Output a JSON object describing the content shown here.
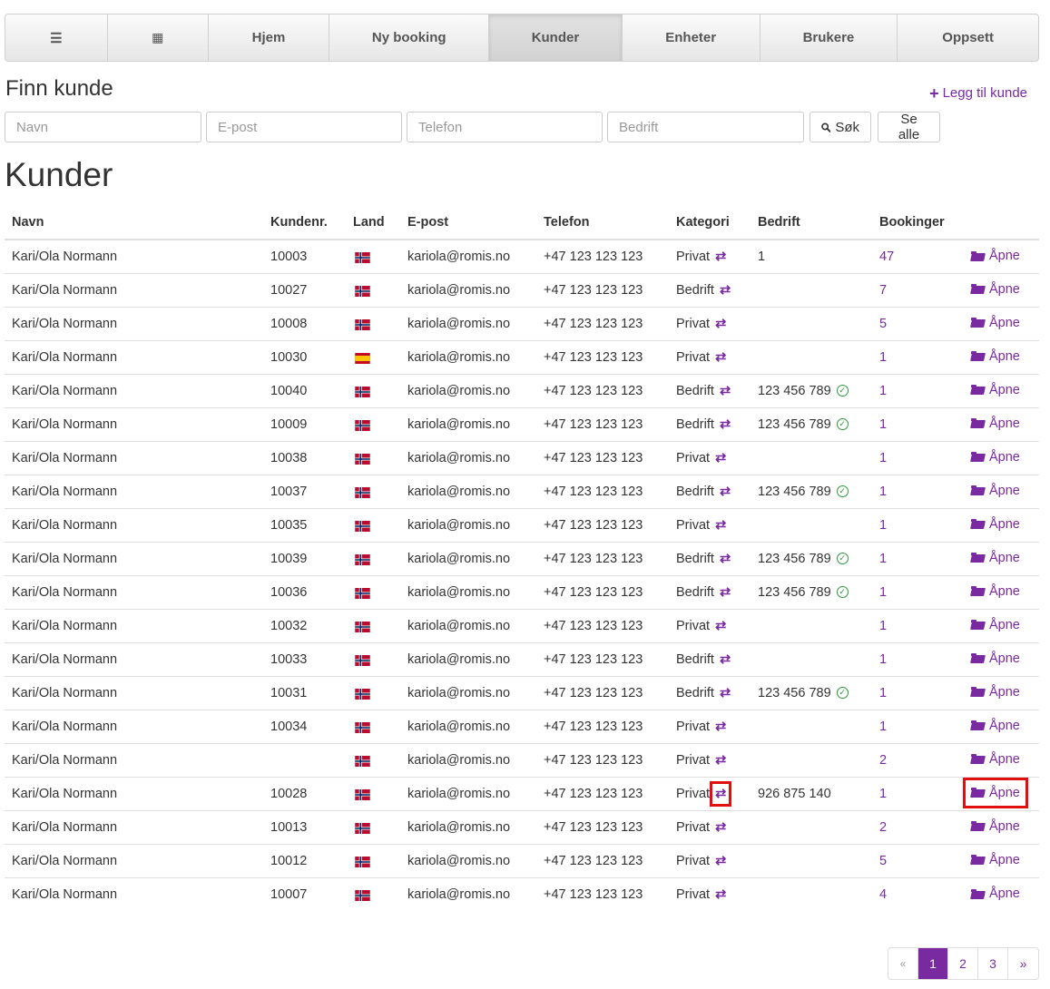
{
  "nav": {
    "items": [
      {
        "label": "☰",
        "icon": "menu-icon"
      },
      {
        "label": "▦",
        "icon": "calendar-icon"
      },
      {
        "label": "Hjem"
      },
      {
        "label": "Ny booking"
      },
      {
        "label": "Kunder"
      },
      {
        "label": "Enheter"
      },
      {
        "label": "Brukere"
      },
      {
        "label": "Oppsett"
      }
    ],
    "active": "Kunder"
  },
  "search": {
    "title": "Finn kunde",
    "add_label": "Legg til kunde",
    "name_placeholder": "Navn",
    "email_placeholder": "E-post",
    "phone_placeholder": "Telefon",
    "company_placeholder": "Bedrift",
    "search_label": "Søk",
    "show_all_label": "Se alle"
  },
  "table": {
    "title": "Kunder",
    "headers": [
      "Navn",
      "Kundenr.",
      "Land",
      "E-post",
      "Telefon",
      "Kategori",
      "Bedrift",
      "Bookinger",
      ""
    ],
    "open_label": "Åpne",
    "rows": [
      {
        "name": "Kari/Ola Normann",
        "no": "10003",
        "country": "NO",
        "email": "kariola@romis.no",
        "phone": "+47 123 123 123",
        "category": "Privat",
        "company": "1",
        "verified": false,
        "bookings": "47"
      },
      {
        "name": "Kari/Ola Normann",
        "no": "10027",
        "country": "NO",
        "email": "kariola@romis.no",
        "phone": "+47 123 123 123",
        "category": "Bedrift",
        "company": "",
        "verified": false,
        "bookings": "7"
      },
      {
        "name": "Kari/Ola Normann",
        "no": "10008",
        "country": "NO",
        "email": "kariola@romis.no",
        "phone": "+47 123 123 123",
        "category": "Privat",
        "company": "",
        "verified": false,
        "bookings": "5"
      },
      {
        "name": "Kari/Ola Normann",
        "no": "10030",
        "country": "ES",
        "email": "kariola@romis.no",
        "phone": "+47 123 123 123",
        "category": "Privat",
        "company": "",
        "verified": false,
        "bookings": "1"
      },
      {
        "name": "Kari/Ola Normann",
        "no": "10040",
        "country": "NO",
        "email": "kariola@romis.no",
        "phone": "+47 123 123 123",
        "category": "Bedrift",
        "company": "123 456 789",
        "verified": true,
        "bookings": "1"
      },
      {
        "name": "Kari/Ola Normann",
        "no": "10009",
        "country": "NO",
        "email": "kariola@romis.no",
        "phone": "+47 123 123 123",
        "category": "Bedrift",
        "company": "123 456 789",
        "verified": true,
        "bookings": "1"
      },
      {
        "name": "Kari/Ola Normann",
        "no": "10038",
        "country": "NO",
        "email": "kariola@romis.no",
        "phone": "+47 123 123 123",
        "category": "Privat",
        "company": "",
        "verified": false,
        "bookings": "1"
      },
      {
        "name": "Kari/Ola Normann",
        "no": "10037",
        "country": "NO",
        "email": "kariola@romis.no",
        "phone": "+47 123 123 123",
        "category": "Bedrift",
        "company": "123 456 789",
        "verified": true,
        "bookings": "1"
      },
      {
        "name": "Kari/Ola Normann",
        "no": "10035",
        "country": "NO",
        "email": "kariola@romis.no",
        "phone": "+47 123 123 123",
        "category": "Privat",
        "company": "",
        "verified": false,
        "bookings": "1"
      },
      {
        "name": "Kari/Ola Normann",
        "no": "10039",
        "country": "NO",
        "email": "kariola@romis.no",
        "phone": "+47 123 123 123",
        "category": "Bedrift",
        "company": "123 456 789",
        "verified": true,
        "bookings": "1"
      },
      {
        "name": "Kari/Ola Normann",
        "no": "10036",
        "country": "NO",
        "email": "kariola@romis.no",
        "phone": "+47 123 123 123",
        "category": "Bedrift",
        "company": "123 456 789",
        "verified": true,
        "bookings": "1"
      },
      {
        "name": "Kari/Ola Normann",
        "no": "10032",
        "country": "NO",
        "email": "kariola@romis.no",
        "phone": "+47 123 123 123",
        "category": "Privat",
        "company": "",
        "verified": false,
        "bookings": "1"
      },
      {
        "name": "Kari/Ola Normann",
        "no": "10033",
        "country": "NO",
        "email": "kariola@romis.no",
        "phone": "+47 123 123 123",
        "category": "Bedrift",
        "company": "",
        "verified": false,
        "bookings": "1"
      },
      {
        "name": "Kari/Ola Normann",
        "no": "10031",
        "country": "NO",
        "email": "kariola@romis.no",
        "phone": "+47 123 123 123",
        "category": "Bedrift",
        "company": "123 456 789",
        "verified": true,
        "bookings": "1"
      },
      {
        "name": "Kari/Ola Normann",
        "no": "10034",
        "country": "NO",
        "email": "kariola@romis.no",
        "phone": "+47 123 123 123",
        "category": "Privat",
        "company": "",
        "verified": false,
        "bookings": "1"
      },
      {
        "name": "Kari/Ola Normann",
        "no": "",
        "country": "NO",
        "email": "kariola@romis.no",
        "phone": "+47 123 123 123",
        "category": "Privat",
        "company": "",
        "verified": false,
        "bookings": "2"
      },
      {
        "name": "Kari/Ola Normann",
        "no": "10028",
        "country": "NO",
        "email": "kariola@romis.no",
        "phone": "+47 123 123 123",
        "category": "Privat",
        "company": "926 875 140",
        "verified": false,
        "bookings": "1",
        "highlighted": true
      },
      {
        "name": "Kari/Ola Normann",
        "no": "10013",
        "country": "NO",
        "email": "kariola@romis.no",
        "phone": "+47 123 123 123",
        "category": "Privat",
        "company": "",
        "verified": false,
        "bookings": "2"
      },
      {
        "name": "Kari/Ola Normann",
        "no": "10012",
        "country": "NO",
        "email": "kariola@romis.no",
        "phone": "+47 123 123 123",
        "category": "Privat",
        "company": "",
        "verified": false,
        "bookings": "5"
      },
      {
        "name": "Kari/Ola Normann",
        "no": "10007",
        "country": "NO",
        "email": "kariola@romis.no",
        "phone": "+47 123 123 123",
        "category": "Privat",
        "company": "",
        "verified": false,
        "bookings": "4"
      }
    ]
  },
  "pagination": {
    "prev": "«",
    "pages": [
      "1",
      "2",
      "3"
    ],
    "current": "1",
    "next": "»"
  },
  "colors": {
    "accent": "#7a2aa0",
    "highlight": "#e01010",
    "verified": "#2a9a3a"
  }
}
